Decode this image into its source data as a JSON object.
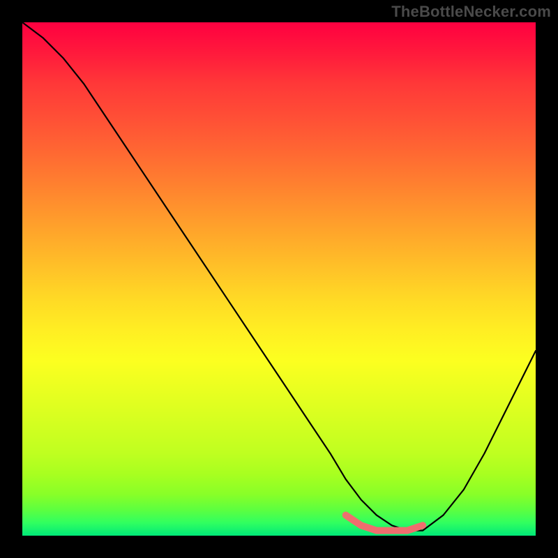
{
  "attribution": "TheBottleNecker.com",
  "chart_data": {
    "type": "line",
    "title": "",
    "xlabel": "",
    "ylabel": "",
    "xlim": [
      0,
      100
    ],
    "ylim": [
      0,
      100
    ],
    "grid": false,
    "legend_position": "none",
    "series": [
      {
        "name": "black-curve",
        "color": "#000000",
        "x": [
          0,
          4,
          8,
          12,
          16,
          20,
          24,
          28,
          32,
          36,
          40,
          44,
          48,
          52,
          56,
          60,
          63,
          66,
          69,
          72,
          75,
          78,
          82,
          86,
          90,
          94,
          98,
          100
        ],
        "y": [
          100,
          97,
          93,
          88,
          82,
          76,
          70,
          64,
          58,
          52,
          46,
          40,
          34,
          28,
          22,
          16,
          11,
          7,
          4,
          2,
          1,
          1,
          4,
          9,
          16,
          24,
          32,
          36
        ]
      },
      {
        "name": "pink-trough-segment",
        "color": "#ef6e6e",
        "x": [
          63,
          66,
          69,
          72,
          75,
          78
        ],
        "y": [
          4,
          2,
          1,
          1,
          1,
          2
        ]
      }
    ],
    "gradient_stops": [
      {
        "pos": 0,
        "color": "#ff0040"
      },
      {
        "pos": 6,
        "color": "#ff1a3c"
      },
      {
        "pos": 12,
        "color": "#ff3838"
      },
      {
        "pos": 18,
        "color": "#ff4d36"
      },
      {
        "pos": 24,
        "color": "#ff6333"
      },
      {
        "pos": 30,
        "color": "#ff7a30"
      },
      {
        "pos": 36,
        "color": "#ff922d"
      },
      {
        "pos": 42,
        "color": "#ffaa2a"
      },
      {
        "pos": 48,
        "color": "#ffc228"
      },
      {
        "pos": 54,
        "color": "#ffda25"
      },
      {
        "pos": 60,
        "color": "#ffee23"
      },
      {
        "pos": 66,
        "color": "#fcff20"
      },
      {
        "pos": 72,
        "color": "#e8ff20"
      },
      {
        "pos": 78,
        "color": "#d4ff20"
      },
      {
        "pos": 84,
        "color": "#bfff20"
      },
      {
        "pos": 88,
        "color": "#a8ff20"
      },
      {
        "pos": 92,
        "color": "#88ff28"
      },
      {
        "pos": 95,
        "color": "#5cff40"
      },
      {
        "pos": 97.5,
        "color": "#30ff60"
      },
      {
        "pos": 100,
        "color": "#00e878"
      }
    ]
  }
}
